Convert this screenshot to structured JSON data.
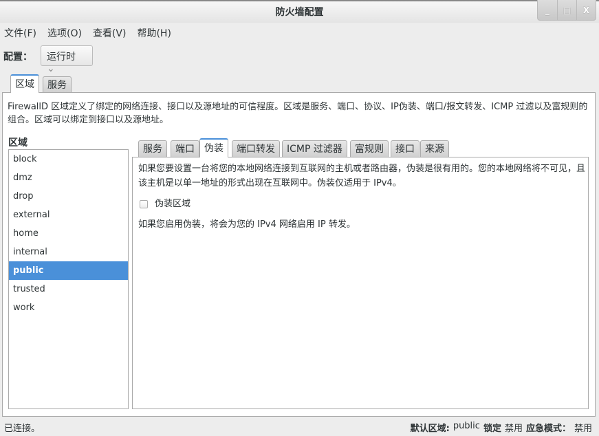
{
  "window": {
    "title": "防火墙配置",
    "buttons": [
      "_",
      "□",
      "X"
    ]
  },
  "menu": [
    "文件(F)",
    "选项(O)",
    "查看(V)",
    "帮助(H)"
  ],
  "config": {
    "label": "配置：",
    "value": "运行时"
  },
  "outer_tabs": [
    "区域",
    "服务"
  ],
  "description": "FirewallD 区域定义了绑定的网络连接、接口以及源地址的可信程度。区域是服务、端口、协议、IP伪装、端口/报文转发、ICMP 过滤以及富规则的组合。区域可以绑定到接口以及源地址。",
  "zones": {
    "label": "区域",
    "items": [
      "block",
      "dmz",
      "drop",
      "external",
      "home",
      "internal",
      "public",
      "trusted",
      "work"
    ],
    "selected": "public"
  },
  "inner_tabs": [
    "服务",
    "端口",
    "伪装",
    "端口转发",
    "ICMP 过滤器",
    "富规则",
    "接口",
    "来源"
  ],
  "masquerade": {
    "info": "如果您要设置一台将您的本地网络连接到互联网的主机或者路由器，伪装是很有用的。您的本地网络将不可见，且该主机是以单一地址的形式出现在互联网中。伪装仅适用于 IPv4。",
    "checkbox_label": "伪装区域",
    "checked": false,
    "note": "如果您启用伪装，将会为您的 IPv4 网络启用 IP 转发。"
  },
  "status": {
    "left": "已连接。",
    "default_zone_label": "默认区域:",
    "default_zone": "public",
    "lock_label": "锁定",
    "lock_value": "禁用",
    "panic_label": "应急模式：",
    "panic_value": "禁用"
  },
  "colors": {
    "accent": "#4a90d9"
  }
}
